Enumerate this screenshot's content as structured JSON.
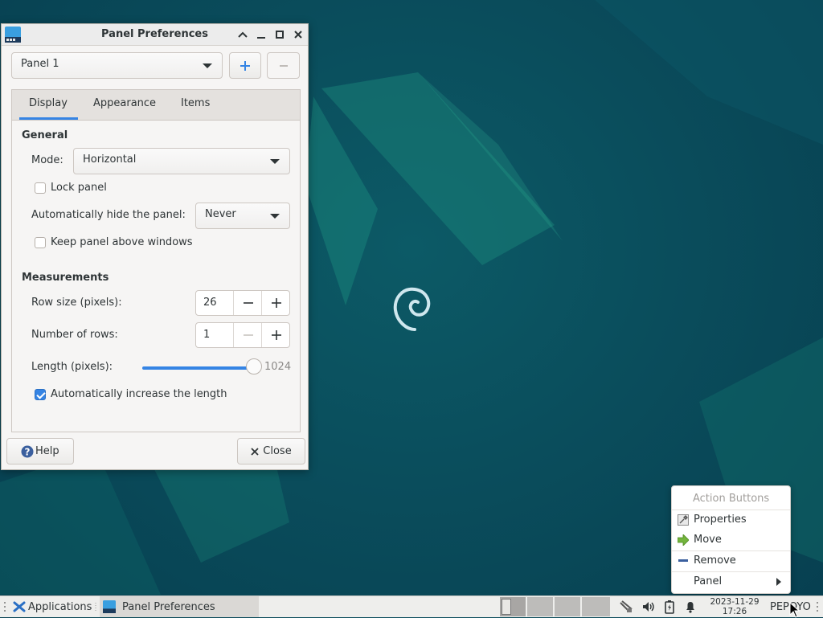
{
  "window": {
    "title": "Panel Preferences",
    "panel_select": "Panel 1",
    "tabs": [
      "Display",
      "Appearance",
      "Items"
    ],
    "active_tab": "Display",
    "general": {
      "heading": "General",
      "mode_label": "Mode:",
      "mode_value": "Horizontal",
      "lock_panel_label": "Lock panel",
      "lock_panel_checked": false,
      "autohide_label": "Automatically hide the panel:",
      "autohide_value": "Never",
      "keep_above_label": "Keep panel above windows",
      "keep_above_checked": false
    },
    "measurements": {
      "heading": "Measurements",
      "row_size_label": "Row size (pixels):",
      "row_size_value": "26",
      "rows_label": "Number of rows:",
      "rows_value": "1",
      "length_label": "Length (pixels):",
      "length_value": "1024",
      "auto_increase_label": "Automatically increase the length",
      "auto_increase_checked": true
    },
    "help_label": "Help",
    "close_label": "Close"
  },
  "context_menu": {
    "header": "Action Buttons",
    "items": [
      "Properties",
      "Move",
      "Remove",
      "Panel"
    ]
  },
  "taskbar": {
    "applications_label": "Applications",
    "task_label": "Panel Preferences",
    "date": "2023-11-29",
    "time": "17:26",
    "user": "PEPOYO"
  },
  "colors": {
    "accent": "#3584e4",
    "desktop": "#0a4d5c"
  }
}
